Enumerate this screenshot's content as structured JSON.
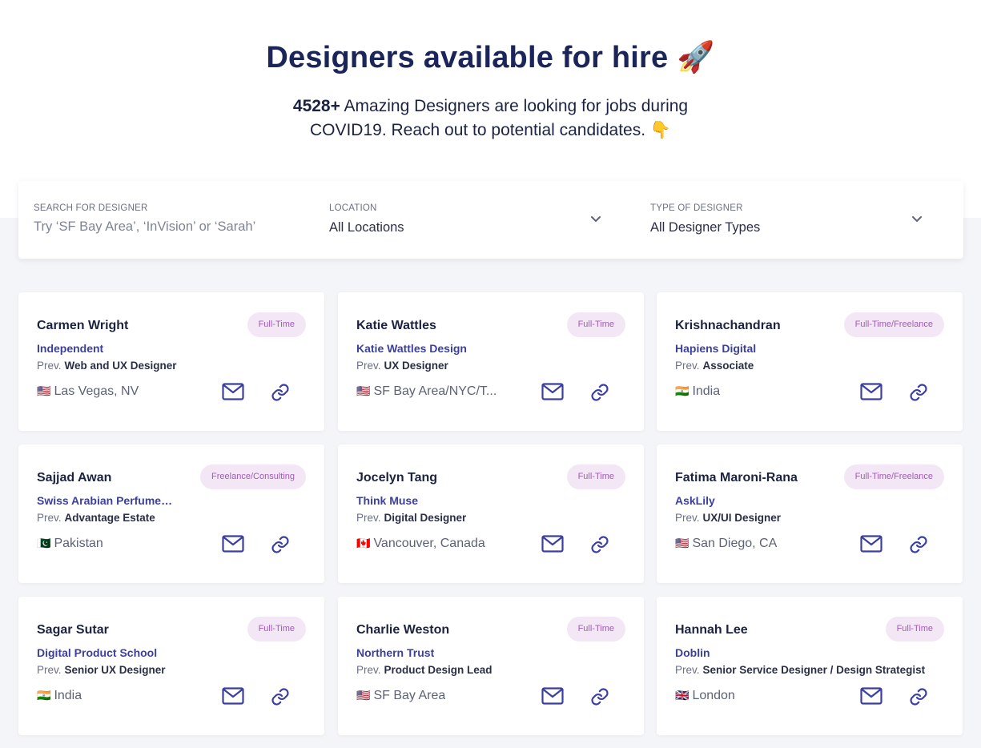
{
  "hero": {
    "title": "Designers available for hire 🚀",
    "count": "4528+",
    "subtitle_rest": " Amazing Designers are looking for jobs during COVID19. Reach out to potential candidates. 👇"
  },
  "filters": {
    "search": {
      "label": "SEARCH FOR DESIGNER",
      "placeholder": "Try ‘SF Bay Area’, ‘InVision’ or ‘Sarah’",
      "value": ""
    },
    "location": {
      "label": "LOCATION",
      "value": "All Locations"
    },
    "type": {
      "label": "TYPE OF DESIGNER",
      "value": "All Designer Types"
    }
  },
  "prev_label": "Prev.",
  "colors": {
    "accent": "#3b3fa0",
    "title": "#1b2559",
    "badge_bg": "#f3e7f6",
    "badge_text": "#a05cb6"
  },
  "designers": [
    {
      "name": "Carmen Wright",
      "badge": "Full-Time",
      "company": "Independent",
      "role": "Web and UX Designer",
      "flag": "🇺🇸",
      "location": "Las Vegas, NV"
    },
    {
      "name": "Katie Wattles",
      "badge": "Full-Time",
      "company": "Katie Wattles Design",
      "role": "UX Designer",
      "flag": "🇺🇸",
      "location": "SF Bay Area/NYC/T..."
    },
    {
      "name": "Krishnachandran",
      "badge": "Full-Time/Freelance",
      "company": "Hapiens Digital",
      "role": "Associate",
      "flag": "🇮🇳",
      "location": "India"
    },
    {
      "name": "Sajjad Awan",
      "badge": "Freelance/Consulting",
      "company": "Swiss Arabian Perfumes ...",
      "role": "Advantage Estate",
      "flag": "🇵🇰",
      "location": "Pakistan"
    },
    {
      "name": "Jocelyn Tang",
      "badge": "Full-Time",
      "company": "Think Muse",
      "role": "Digital Designer",
      "flag": "🇨🇦",
      "location": "Vancouver, Canada"
    },
    {
      "name": "Fatima Maroni-Rana",
      "badge": "Full-Time/Freelance",
      "company": "AskLily",
      "role": "UX/UI Designer",
      "flag": "🇺🇸",
      "location": "San Diego, CA"
    },
    {
      "name": "Sagar Sutar",
      "badge": "Full-Time",
      "company": "Digital Product School",
      "role": "Senior UX Designer",
      "flag": "🇮🇳",
      "location": "India"
    },
    {
      "name": "Charlie Weston",
      "badge": "Full-Time",
      "company": "Northern Trust",
      "role": "Product Design Lead",
      "flag": "🇺🇸",
      "location": "SF Bay Area"
    },
    {
      "name": "Hannah Lee",
      "badge": "Full-Time",
      "company": "Doblin",
      "role": "Senior Service Designer / Design Strategist",
      "flag": "🇬🇧",
      "location": "London"
    }
  ]
}
